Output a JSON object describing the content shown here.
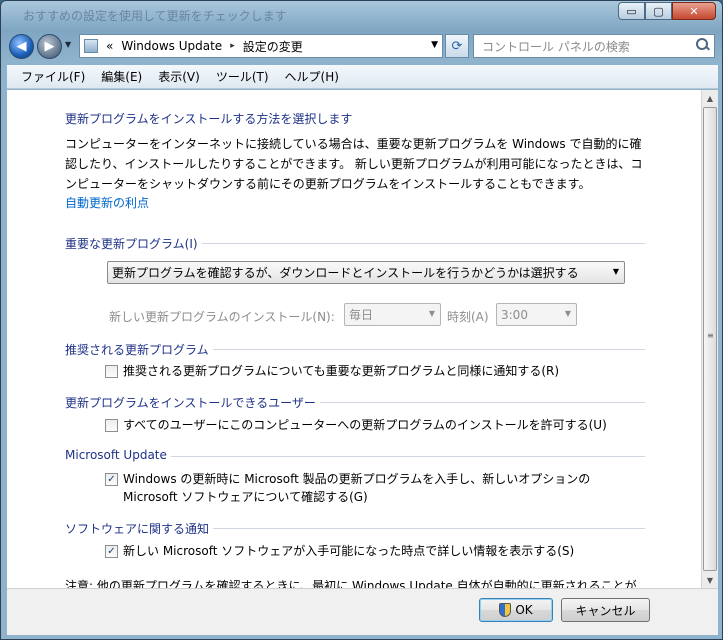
{
  "window": {
    "title": "おすすめの設定を使用して更新をチェックします",
    "buttons": {
      "minimize": "▭",
      "maximize": "▢",
      "close": "✕"
    }
  },
  "nav": {
    "breadcrumb_prefix": "«",
    "breadcrumb_1": "Windows Update",
    "breadcrumb_sep": "▸",
    "breadcrumb_2": "設定の変更",
    "search_placeholder": "コントロール パネルの検索"
  },
  "menu": [
    "ファイル(F)",
    "編集(E)",
    "表示(V)",
    "ツール(T)",
    "ヘルプ(H)"
  ],
  "main": {
    "heading": "更新プログラムをインストールする方法を選択します",
    "description": "コンピューターをインターネットに接続している場合は、重要な更新プログラムを Windows で自動的に確認したり、インストールしたりすることができます。 新しい更新プログラムが利用可能になったときは、コンピューターをシャットダウンする前にその更新プログラムをインストールすることもできます。",
    "benefits_link": "自動更新の利点",
    "important": {
      "label": "重要な更新プログラム(I)",
      "selected": "更新プログラムを確認するが、ダウンロードとインストールを行うかどうかは選択する",
      "install_label": "新しい更新プログラムのインストール(N):",
      "day_value": "毎日",
      "time_label": "時刻(A)",
      "time_value": "3:00"
    },
    "recommended": {
      "label": "推奨される更新プログラム",
      "checkbox_label": "推奨される更新プログラムについても重要な更新プログラムと同様に通知する(R)",
      "checked": false
    },
    "users": {
      "label": "更新プログラムをインストールできるユーザー",
      "checkbox_label": "すべてのユーザーにこのコンピューターへの更新プログラムのインストールを許可する(U)",
      "checked": false
    },
    "microsoft_update": {
      "label": "Microsoft Update",
      "checkbox_label": "Windows の更新時に Microsoft 製品の更新プログラムを入手し、新しいオプションの Microsoft ソフトウェアについて確認する(G)",
      "checked": true
    },
    "software_notify": {
      "label": "ソフトウェアに関する通知",
      "checkbox_label": "新しい Microsoft ソフトウェアが入手可能になった時点で詳しい情報を表示する(S)",
      "checked": true
    },
    "note_cut": "注意: 他の更新プログラムを確認するときに、最初に Windows Update 自体が自動的に更新されることが"
  },
  "footer": {
    "ok": "OK",
    "cancel": "キャンセル"
  },
  "check_glyph": "✓"
}
